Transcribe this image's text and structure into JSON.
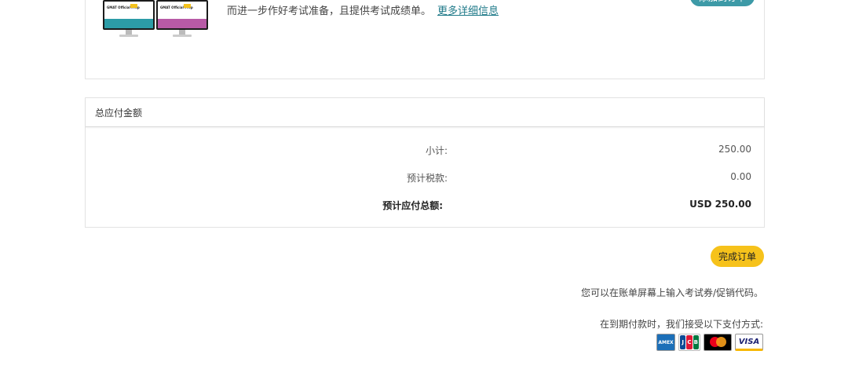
{
  "product": {
    "description": "而进一步作好考试准备，且提供考试成绩单。",
    "more_link": "更多详细信息",
    "add_button": "添加到订单",
    "image_brand": "GMAT Official Prep"
  },
  "totals": {
    "header": "总应付金额",
    "subtotal_label": "小计:",
    "subtotal_value": "250.00",
    "tax_label": "预计税款:",
    "tax_value": "0.00",
    "total_label": "预计应付总额:",
    "total_value": "USD 250.00"
  },
  "actions": {
    "complete_order": "完成订单"
  },
  "notes": {
    "voucher": "您可以在账单屏幕上输入考试券/促销代码。",
    "payment": "在到期付款时，我们接受以下支付方式:"
  },
  "payment_methods": [
    {
      "name": "AMEX"
    },
    {
      "name": "JCB"
    },
    {
      "name": "mastercard"
    },
    {
      "name": "VISA"
    }
  ],
  "colors": {
    "accent_teal": "#3d9aa7",
    "complete_yellow": "#f6c21b",
    "link": "#1f7a89"
  }
}
